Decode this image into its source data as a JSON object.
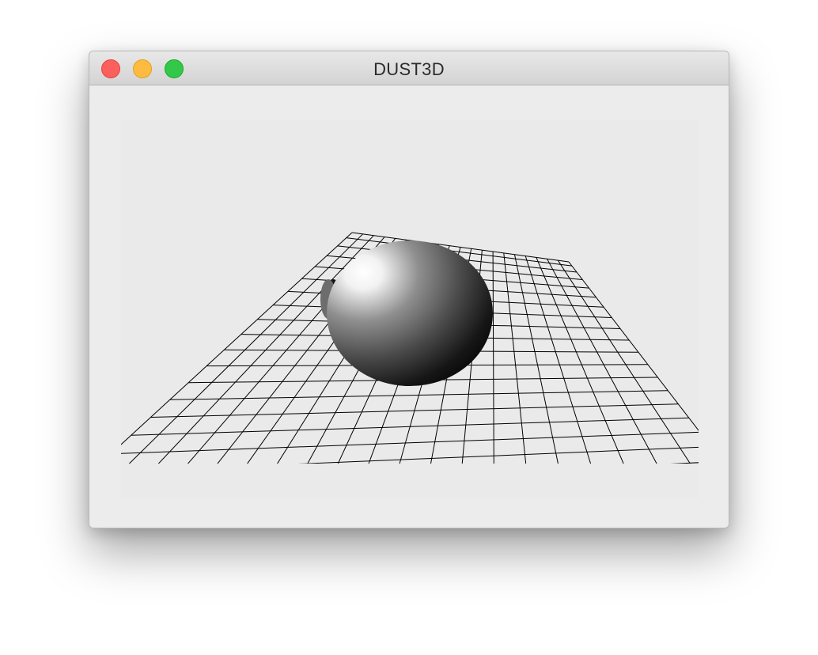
{
  "window": {
    "title": "DUST3D",
    "controls": {
      "close": "close-icon",
      "minimize": "minimize-icon",
      "zoom": "zoom-icon"
    },
    "colors": {
      "close": "#fc605c",
      "minimize": "#fdbc40",
      "zoom": "#34c84a"
    }
  },
  "viewport": {
    "scene": "3d-preview",
    "background": "#eaeaea",
    "grid_color": "#000000",
    "mesh_color": "#808080"
  }
}
